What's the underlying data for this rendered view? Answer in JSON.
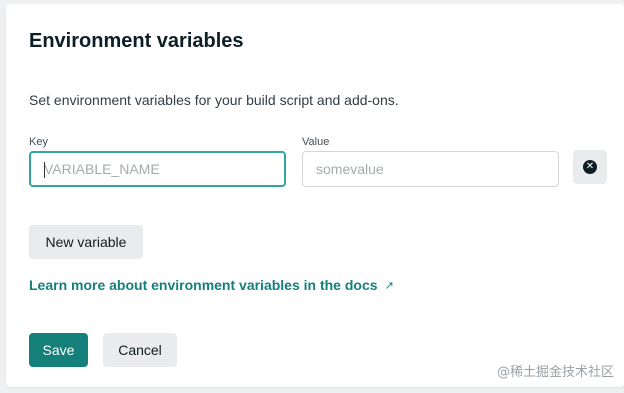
{
  "panel": {
    "title": "Environment variables",
    "description": "Set environment variables for your build script and add-ons."
  },
  "fields": {
    "key_label": "Key",
    "key_placeholder": "VARIABLE_NAME",
    "value_label": "Value",
    "value_placeholder": "somevalue"
  },
  "actions": {
    "new_variable": "New variable",
    "docs_link": "Learn more about environment variables in the docs",
    "docs_link_icon": "external-arrow-icon",
    "remove_icon": "close-circle-icon",
    "save": "Save",
    "cancel": "Cancel"
  },
  "watermark": "@稀土掘金技术社区",
  "colors": {
    "accent": "#157f7a",
    "focus_border": "#30a8a0",
    "secondary_button": "#e9ebec"
  }
}
